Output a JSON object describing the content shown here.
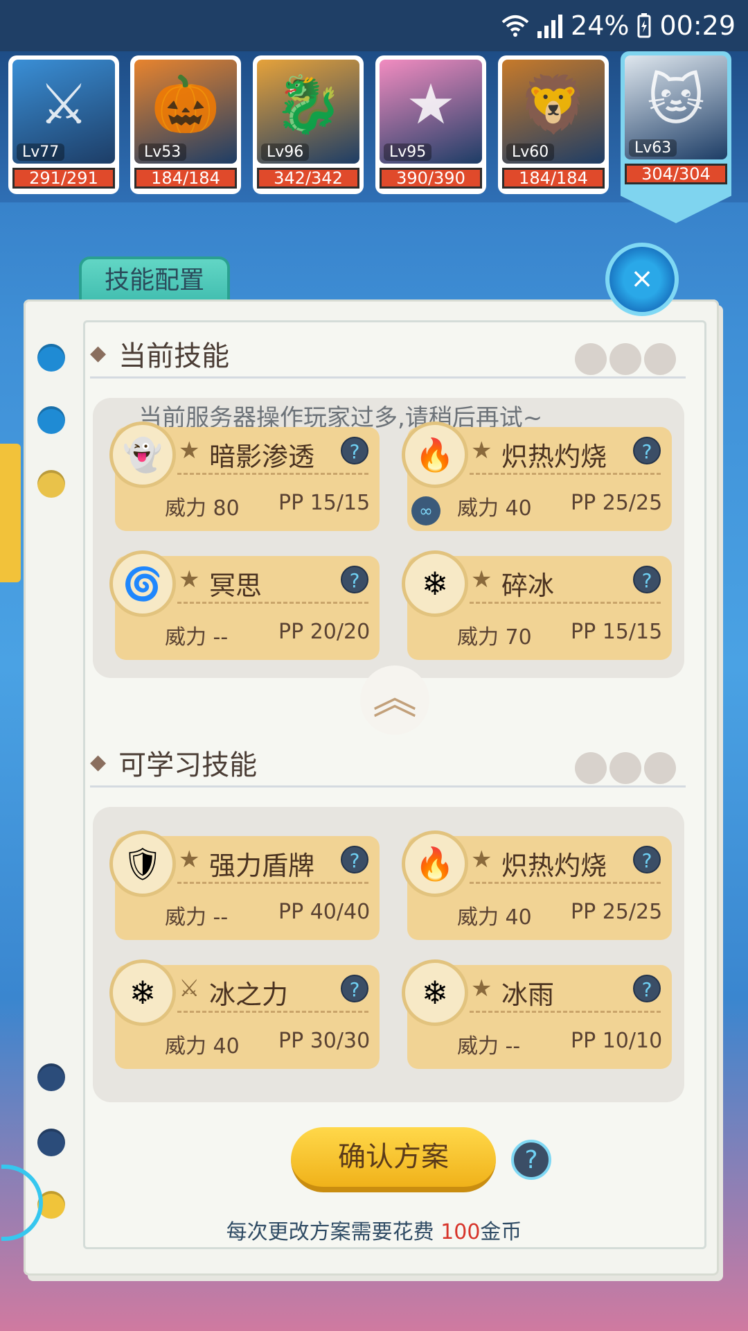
{
  "status_bar": {
    "battery": "24%",
    "time": "00:29"
  },
  "pets": [
    {
      "level": "Lv77",
      "hp": "291/291",
      "color": "#3a8fd6",
      "glyph": "⚔"
    },
    {
      "level": "Lv53",
      "hp": "184/184",
      "color": "#e8842e",
      "glyph": "🎃"
    },
    {
      "level": "Lv96",
      "hp": "342/342",
      "color": "#e6a23a",
      "glyph": "🐉"
    },
    {
      "level": "Lv95",
      "hp": "390/390",
      "color": "#f28cc0",
      "glyph": "★"
    },
    {
      "level": "Lv60",
      "hp": "184/184",
      "color": "#c77a2a",
      "glyph": "🦁"
    },
    {
      "level": "Lv63",
      "hp": "304/304",
      "color": "#dfe7ee",
      "glyph": "🐱"
    }
  ],
  "panel": {
    "tab_label": "技能配置",
    "close_label": "×"
  },
  "current_section": {
    "title": "当前技能",
    "notice": "当前服务器操作玩家过多,请稍后再试~",
    "skills": [
      {
        "name": "暗影渗透",
        "power": "威力 80",
        "pp": "PP 15/15",
        "icon": "ghost-icon",
        "glyph": "👻",
        "type_glyph": "★",
        "linked": false
      },
      {
        "name": "炽热灼烧",
        "power": "威力 40",
        "pp": "PP 25/25",
        "icon": "fire-icon",
        "glyph": "🔥",
        "type_glyph": "★",
        "linked": true
      },
      {
        "name": "冥思",
        "power": "威力 --",
        "pp": "PP 20/20",
        "icon": "swirl-icon",
        "glyph": "🌀",
        "type_glyph": "★",
        "linked": false
      },
      {
        "name": "碎冰",
        "power": "威力 70",
        "pp": "PP 15/15",
        "icon": "snowflake-icon",
        "glyph": "❄",
        "type_glyph": "★",
        "linked": false
      }
    ]
  },
  "learnable_section": {
    "title": "可学习技能",
    "skills": [
      {
        "name": "强力盾牌",
        "power": "威力 --",
        "pp": "PP 40/40",
        "icon": "shield-icon",
        "glyph": "🛡",
        "type_glyph": "★"
      },
      {
        "name": "炽热灼烧",
        "power": "威力 40",
        "pp": "PP 25/25",
        "icon": "fire-icon",
        "glyph": "🔥",
        "type_glyph": "★"
      },
      {
        "name": "冰之力",
        "power": "威力 40",
        "pp": "PP 30/30",
        "icon": "snowflake-icon",
        "glyph": "❄",
        "type_glyph": "⚔"
      },
      {
        "name": "冰雨",
        "power": "威力 --",
        "pp": "PP 10/10",
        "icon": "snowflake-icon",
        "glyph": "❄",
        "type_glyph": "★"
      }
    ]
  },
  "footer": {
    "confirm_label": "确认方案",
    "cost_prefix": "每次更改方案需要花费 ",
    "cost_amount": "100",
    "cost_suffix": "金币"
  }
}
